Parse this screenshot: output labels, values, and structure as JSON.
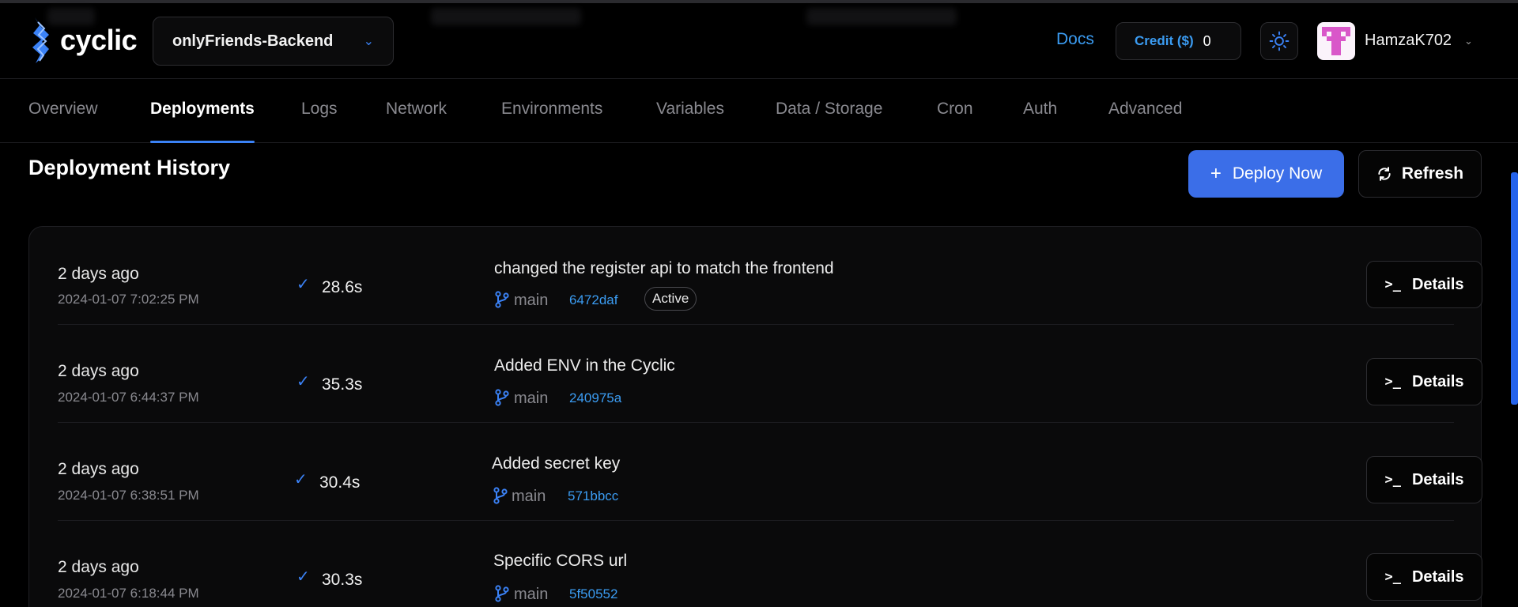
{
  "app": {
    "logo_text": "cyclic",
    "project_name": "onlyFriends-Backend"
  },
  "header": {
    "docs_label": "Docs",
    "credit_label": "Credit ($)",
    "credit_value": "0",
    "username": "HamzaK702"
  },
  "tabs": [
    {
      "label": "Overview",
      "active": false
    },
    {
      "label": "Deployments",
      "active": true
    },
    {
      "label": "Logs",
      "active": false
    },
    {
      "label": "Network",
      "active": false
    },
    {
      "label": "Environments",
      "active": false
    },
    {
      "label": "Variables",
      "active": false
    },
    {
      "label": "Data / Storage",
      "active": false
    },
    {
      "label": "Cron",
      "active": false
    },
    {
      "label": "Auth",
      "active": false
    },
    {
      "label": "Advanced",
      "active": false
    }
  ],
  "main": {
    "title": "Deployment History",
    "deploy_label": "Deploy Now",
    "refresh_label": "Refresh",
    "deployments": [
      {
        "relative": "2 days ago",
        "timestamp": "2024-01-07 7:02:25 PM",
        "duration": "28.6s",
        "message": "changed the register api to match the frontend",
        "branch": "main",
        "commit": "6472daf",
        "badge": "Active",
        "details_label": "Details"
      },
      {
        "relative": "2 days ago",
        "timestamp": "2024-01-07 6:44:37 PM",
        "duration": "35.3s",
        "message": "Added ENV in the Cyclic",
        "branch": "main",
        "commit": "240975a",
        "badge": "",
        "details_label": "Details"
      },
      {
        "relative": "2 days ago",
        "timestamp": "2024-01-07 6:38:51 PM",
        "duration": "30.4s",
        "message": "Added secret key",
        "branch": "main",
        "commit": "571bbcc",
        "badge": "",
        "details_label": "Details"
      },
      {
        "relative": "2 days ago",
        "timestamp": "2024-01-07 6:18:44 PM",
        "duration": "30.3s",
        "message": "Specific CORS url",
        "branch": "main",
        "commit": "5f50552",
        "badge": "",
        "details_label": "Details"
      }
    ]
  },
  "colors": {
    "accent": "#3b82f6",
    "link": "#3b9cf2",
    "background": "#000000"
  },
  "icons": [
    "cyclic-logo-icon",
    "chevron-down-icon",
    "sun-icon",
    "avatar-identicon",
    "plus-icon",
    "refresh-icon",
    "check-icon",
    "git-branch-icon",
    "terminal-icon"
  ]
}
